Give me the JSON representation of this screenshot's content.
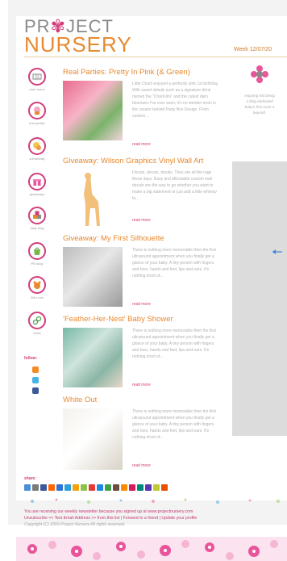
{
  "brand": {
    "line1_parts": [
      "PR",
      "✾",
      "JECT"
    ],
    "line2": "NURSERY"
  },
  "header": {
    "week": "Week 12/07/20"
  },
  "nav": [
    {
      "label": "real rooms",
      "icon": "crib-icon"
    },
    {
      "label": "real parties",
      "icon": "cupcake-icon"
    },
    {
      "label": "community",
      "icon": "chat-icon"
    },
    {
      "label": "giveaways",
      "icon": "gift-icon"
    },
    {
      "label": "daily blog",
      "icon": "blocks-icon"
    },
    {
      "label": "PN shop",
      "icon": "bag-icon"
    },
    {
      "label": "We Love",
      "icon": "bear-icon"
    },
    {
      "label": "news",
      "icon": "link-icon"
    }
  ],
  "follow": {
    "label": "follow:"
  },
  "articles": [
    {
      "title": "Real Parties: Pretty In Pink (& Green)",
      "body": "Little Charli enjoyed a perfectly pink 1st birthday. With sweet details such as a signature drink named the \"Charli-tini\" and the cutest darn bloomers I've ever seen, it's no wonder mom is the creator behind Party Box Design. From custom...",
      "read_more": "read more"
    },
    {
      "title": "Giveaway: Wilson Graphics Vinyl Wall Art",
      "body": "Decals, decals, decals. They are all the rage these days. Easy and affordable custom wall decals are the way to go whether you want to make a big statement or just add a little whimsy to...",
      "read_more": "read more"
    },
    {
      "title": "Giveaway: My First Silhouette",
      "body": "There is nothing more memorable then the first ultrasound appointment when you finally get a glance of your baby. A tiny person with fingers and toes, hands and feet, lips and ears. It's nothing short of...",
      "read_more": "read more"
    },
    {
      "title": "'Feather-Her-Nest' Baby Shower",
      "body": "There is nothing more memorable then the first ultrasound appointment when you finally get a glance of your baby. A tiny person with fingers and toes, hands and feet, lips and ears. It's nothing short of...",
      "read_more": "read more"
    },
    {
      "title": "White Out",
      "body": "There is nothing more memorable then the first ultrasound appointment when you finally get a glance of your baby. A tiny person with fingers and toes, hands and feet, lips and ears. It's nothing short of...",
      "read_more": "read more"
    }
  ],
  "right_column": {
    "lines": [
      "Inspiring Kid Desig",
      "A blog dedicated",
      "baby's first room a",
      "beyond."
    ]
  },
  "share": {
    "label": "share:"
  },
  "footer": {
    "line1": "You are receiving our weekly newsletter because you signed up at www.projectnursery.com",
    "line2": "Unsubscribe << Test Email Address >> from this list | Forward to a friend | Update your profile",
    "copyright": "Copyright (C) 2009 Project Nursery All rights reserved."
  },
  "colors": {
    "accent_orange": "#e8892f",
    "accent_pink": "#d33c7a",
    "text_gray": "#b0b0b0"
  }
}
